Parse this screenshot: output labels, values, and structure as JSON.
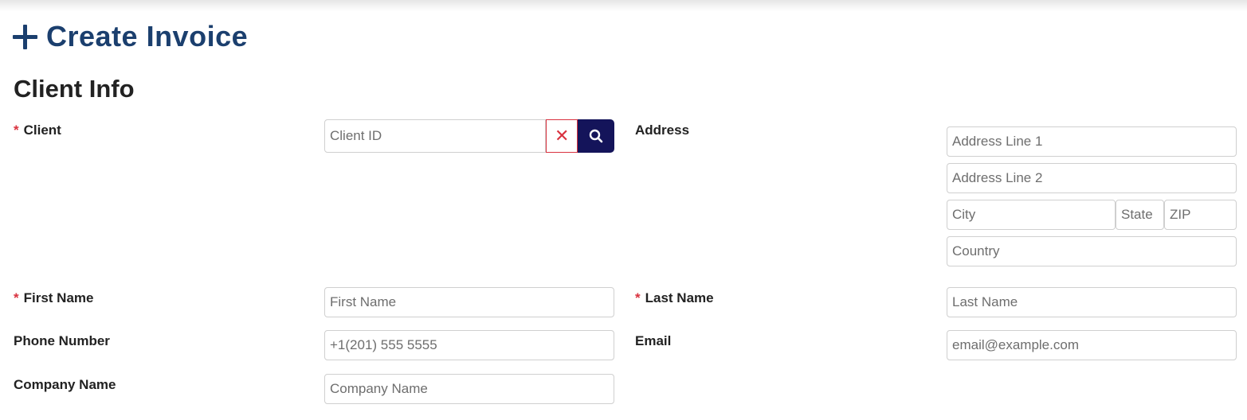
{
  "header": {
    "title": "Create Invoice"
  },
  "section": {
    "title": "Client Info"
  },
  "required_marker": "*",
  "client": {
    "label": "Client",
    "placeholder": "Client ID",
    "clear_symbol": "✕"
  },
  "address": {
    "label": "Address",
    "line1_placeholder": "Address Line 1",
    "line2_placeholder": "Address Line 2",
    "city_placeholder": "City",
    "state_placeholder": "State",
    "zip_placeholder": "ZIP",
    "country_placeholder": "Country"
  },
  "first_name": {
    "label": "First Name",
    "placeholder": "First Name"
  },
  "last_name": {
    "label": "Last Name",
    "placeholder": "Last Name"
  },
  "phone": {
    "label": "Phone Number",
    "placeholder": "+1(201) 555 5555"
  },
  "email": {
    "label": "Email",
    "placeholder": "email@example.com"
  },
  "company": {
    "label": "Company Name",
    "placeholder": "Company Name"
  },
  "colors": {
    "title": "#1b3f6e",
    "required": "#d9323f",
    "search_button": "#14145a"
  }
}
